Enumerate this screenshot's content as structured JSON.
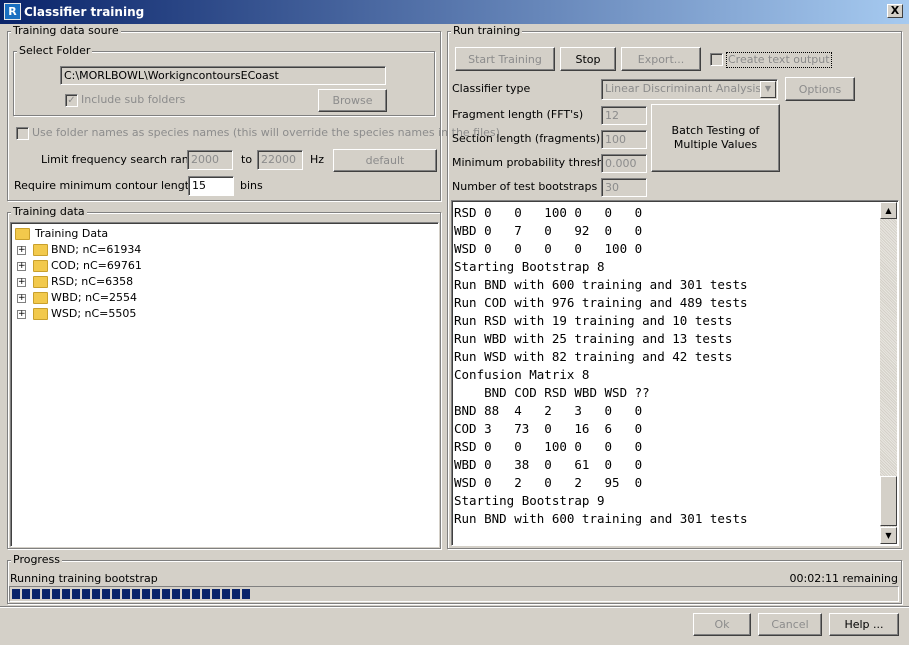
{
  "window": {
    "title": "Classifier training",
    "app_icon_letter": "R",
    "close_label": "X"
  },
  "training_source": {
    "group_label": "Training data soure",
    "folder_group_label": "Select Folder",
    "folder_path": "C:\\MORLBOWL\\WorkigncontoursECoast",
    "include_subfolders_label": "Include sub folders",
    "include_subfolders_checked": true,
    "browse_label": "Browse",
    "use_folder_names_label": "Use folder names as species names (this will override the species names in the files)",
    "use_folder_names_checked": false,
    "freq_label": "Limit frequency search range",
    "freq_min": "2000",
    "freq_to": "to",
    "freq_max": "22000",
    "freq_unit": "Hz",
    "default_label": "default",
    "min_contour_label": "Require minimum contour length of",
    "min_contour_value": "15",
    "min_contour_unit": "bins"
  },
  "training_data": {
    "group_label": "Training Data",
    "group_label_display": "Training data",
    "root": "Training Data",
    "items": [
      {
        "label": "BND; nC=61934"
      },
      {
        "label": "COD; nC=69761"
      },
      {
        "label": "RSD; nC=6358"
      },
      {
        "label": "WBD; nC=2554"
      },
      {
        "label": "WSD; nC=5505"
      }
    ]
  },
  "run_training": {
    "group_label": "Run training",
    "start_label": "Start Training",
    "stop_label": "Stop",
    "export_label": "Export...",
    "create_text_output_label": "Create text output",
    "create_text_output_checked": false,
    "classifier_type_label": "Classifier type",
    "classifier_type_value": "Linear Discriminant Analysis",
    "options_label": "Options",
    "fragment_length_label": "Fragment length (FFT's)",
    "fragment_length_value": "12",
    "section_length_label": "Section length (fragments)",
    "section_length_value": "100",
    "min_prob_label": "Minimum probability threshold",
    "min_prob_value": "0.000",
    "num_bootstraps_label": "Number of test bootstraps",
    "num_bootstraps_value": "30",
    "batch_label": "Batch Testing of Multiple Values",
    "console_lines": [
      "RSD 0   0   100 0   0   0",
      "WBD 0   7   0   92  0   0",
      "WSD 0   0   0   0   100 0",
      "Starting Bootstrap 8",
      "Run BND with 600 training and 301 tests",
      "Run COD with 976 training and 489 tests",
      "Run RSD with 19 training and 10 tests",
      "Run WBD with 25 training and 13 tests",
      "Run WSD with 82 training and 42 tests",
      "Confusion Matrix 8",
      "    BND COD RSD WBD WSD ??",
      "BND 88  4   2   3   0   0",
      "COD 3   73  0   16  6   0",
      "RSD 0   0   100 0   0   0",
      "WBD 0   38  0   61  0   0",
      "WSD 0   2   0   2   95  0",
      "Starting Bootstrap 9",
      "Run BND with 600 training and 301 tests"
    ]
  },
  "progress": {
    "group_label": "Progress",
    "status": "Running training bootstrap",
    "remaining": "00:02:11 remaining",
    "fraction": 0.27
  },
  "footer": {
    "ok_label": "Ok",
    "cancel_label": "Cancel",
    "help_label": "Help ..."
  },
  "colors": {
    "title_start": "#0a246a",
    "title_end": "#a6caf0",
    "progress": "#0a246a",
    "face": "#d4d0c8"
  }
}
